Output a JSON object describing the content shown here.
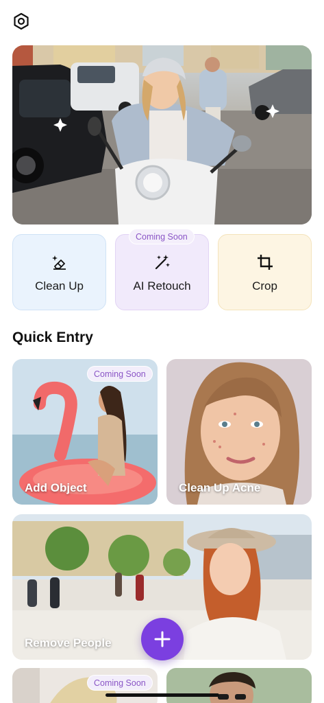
{
  "header": {
    "settings_icon": "gear-icon"
  },
  "hero": {
    "sparkle_icon": "sparkle-icon"
  },
  "tools": [
    {
      "label": "Clean Up",
      "icon": "eraser-sparkle-icon",
      "color": "#eaf3fd"
    },
    {
      "label": "AI Retouch",
      "icon": "magic-wand-icon",
      "color": "#f1eafb",
      "badge": "Coming Soon"
    },
    {
      "label": "Crop",
      "icon": "crop-icon",
      "color": "#fdf5e3"
    }
  ],
  "quick_entry": {
    "title": "Quick Entry",
    "cards": [
      {
        "label": "Add Object",
        "badge": "Coming Soon"
      },
      {
        "label": "Clean Up Acne"
      },
      {
        "label": "Remove People"
      },
      {
        "label": "",
        "badge": "Coming Soon"
      },
      {
        "label": ""
      }
    ]
  },
  "fab": {
    "icon": "plus-icon",
    "color": "#7b3fe0"
  },
  "accent_color": "#8a55c6"
}
